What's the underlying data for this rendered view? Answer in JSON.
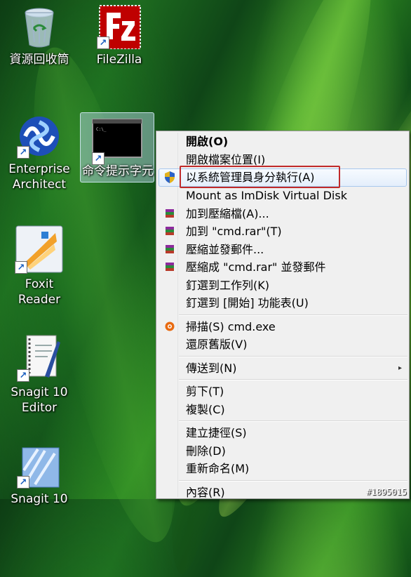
{
  "desktop": {
    "icons": [
      {
        "label": "資源回收筒",
        "icon": "recycle-bin-icon"
      },
      {
        "label": "FileZilla",
        "icon": "filezilla-icon"
      },
      {
        "label": "Enterprise Architect",
        "icon": "enterprise-architect-icon"
      },
      {
        "label": "命令提示字元",
        "icon": "cmd-icon"
      },
      {
        "label": "Foxit Reader",
        "icon": "foxit-reader-icon"
      },
      {
        "label": "Snagit 10 Editor",
        "icon": "snagit-editor-icon"
      },
      {
        "label": "Snagit 10",
        "icon": "snagit-icon"
      }
    ]
  },
  "context_menu": {
    "items": [
      {
        "label": "開啟(O)"
      },
      {
        "label": "開啟檔案位置(I)"
      },
      {
        "label": "以系統管理員身分執行(A)",
        "icon": "uac-shield-icon"
      },
      {
        "label": "Mount as ImDisk Virtual Disk"
      },
      {
        "label": "加到壓縮檔(A)...",
        "icon": "winrar-icon"
      },
      {
        "label": "加到 \"cmd.rar\"(T)",
        "icon": "winrar-icon"
      },
      {
        "label": "壓縮並發郵件...",
        "icon": "winrar-icon"
      },
      {
        "label": "壓縮成 \"cmd.rar\" 並發郵件",
        "icon": "winrar-icon"
      },
      {
        "label": "釘選到工作列(K)"
      },
      {
        "label": "釘選到 [開始] 功能表(U)"
      },
      {
        "label": "掃描(S) cmd.exe",
        "icon": "avast-icon"
      },
      {
        "label": "還原舊版(V)"
      },
      {
        "label": "傳送到(N)",
        "submenu_arrow": "▸"
      },
      {
        "label": "剪下(T)"
      },
      {
        "label": "複製(C)"
      },
      {
        "label": "建立捷徑(S)"
      },
      {
        "label": "刪除(D)"
      },
      {
        "label": "重新命名(M)"
      },
      {
        "label": "內容(R)"
      }
    ]
  },
  "watermark": "#1895015",
  "colors": {
    "highlight_border": "#c02a2a",
    "menu_bg": "#f0f0f0"
  }
}
